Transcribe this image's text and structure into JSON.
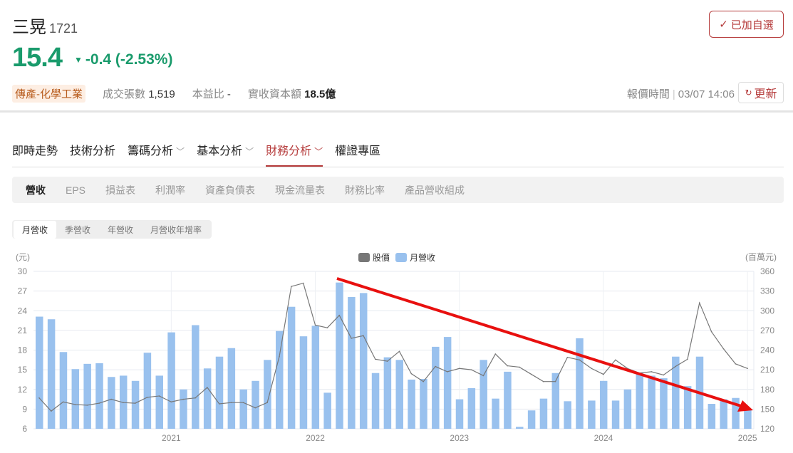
{
  "stock": {
    "name": "三晃",
    "code": "1721",
    "price": "15.4",
    "change": "-0.4 (-2.53%)",
    "industry": "傳產-化學工業",
    "volume_label": "成交張數",
    "volume": "1,519",
    "pe_label": "本益比",
    "pe": "-",
    "capital_label": "實收資本額",
    "capital": "18.5億"
  },
  "header": {
    "follow_label": "已加自選",
    "quote_time_label": "報價時間",
    "quote_time": "03/07 14:06",
    "refresh_label": "更新"
  },
  "nav": [
    {
      "label": "即時走勢"
    },
    {
      "label": "技術分析"
    },
    {
      "label": "籌碼分析",
      "dropdown": true
    },
    {
      "label": "基本分析",
      "dropdown": true
    },
    {
      "label": "財務分析",
      "dropdown": true,
      "active": true
    },
    {
      "label": "權證專區"
    }
  ],
  "subtabs": [
    "營收",
    "EPS",
    "損益表",
    "利潤率",
    "資產負債表",
    "現金流量表",
    "財務比率",
    "產品營收組成"
  ],
  "segments": [
    "月營收",
    "季營收",
    "年營收",
    "月營收年增率"
  ],
  "colors": {
    "price": "#1a9b6c",
    "accent": "#b53a3a",
    "bar": "#99c1ee",
    "line": "#777777",
    "arrow": "#e8100f"
  },
  "chart_data": {
    "type": "bar+line",
    "legend": [
      "股價",
      "月營收"
    ],
    "legend_position": "top-center",
    "left_unit": "(元)",
    "right_unit": "(百萬元)",
    "left_ylim": [
      6,
      30
    ],
    "left_ticks": [
      "30",
      "27",
      "24",
      "21",
      "18",
      "15",
      "12",
      "9",
      "6"
    ],
    "right_ylim": [
      120,
      360
    ],
    "right_ticks": [
      "360",
      "330",
      "300",
      "270",
      "240",
      "210",
      "180",
      "150",
      "120"
    ],
    "start": "2020-02",
    "end": "2025-01",
    "xticks": [
      {
        "label": "2021",
        "index": 11
      },
      {
        "label": "2022",
        "index": 23
      },
      {
        "label": "2023",
        "index": 35
      },
      {
        "label": "2024",
        "index": 47
      },
      {
        "label": "2025",
        "index": 59
      }
    ],
    "revenue": [
      291,
      287,
      237,
      211,
      219,
      220,
      199,
      201,
      193,
      236,
      201,
      267,
      180,
      278,
      212,
      230,
      243,
      180,
      193,
      225,
      269,
      306,
      261,
      277,
      175,
      343,
      321,
      327,
      205,
      229,
      225,
      195,
      196,
      245,
      260,
      165,
      182,
      225,
      166,
      207,
      123,
      148,
      166,
      205,
      162,
      258,
      163,
      193,
      163,
      180,
      205,
      201,
      197,
      230,
      185,
      230,
      158,
      165,
      167,
      150
    ],
    "price": [
      10.7,
      8.7,
      10.1,
      9.7,
      9.6,
      9.9,
      10.5,
      10.0,
      9.9,
      10.8,
      11.0,
      10.1,
      10.5,
      10.7,
      12.3,
      9.8,
      10.0,
      10.0,
      9.2,
      10.0,
      17.0,
      27.7,
      28.2,
      21.8,
      21.4,
      23.3,
      19.8,
      20.2,
      16.6,
      16.3,
      17.8,
      14.4,
      13.2,
      15.5,
      14.7,
      15.2,
      15.0,
      14.1,
      17.4,
      15.6,
      15.4,
      14.3,
      13.2,
      13.2,
      16.9,
      16.5,
      15.2,
      14.3,
      16.5,
      15.2,
      14.5,
      14.7,
      14.2,
      15.5,
      16.6,
      25.2,
      20.8,
      18.2,
      15.9,
      15.2
    ]
  }
}
